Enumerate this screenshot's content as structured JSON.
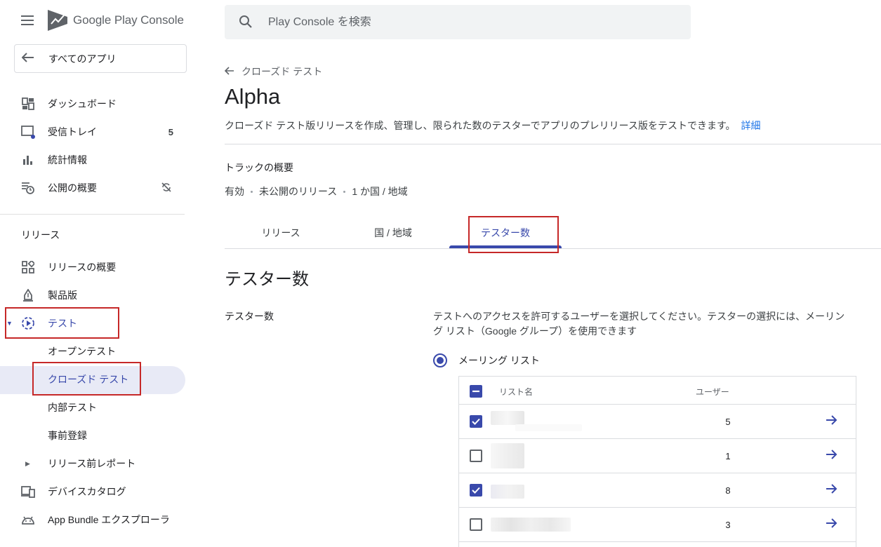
{
  "app": {
    "logo_text": "Google Play Console"
  },
  "sidebar": {
    "all_apps_label": "すべてのアプリ",
    "items": [
      {
        "label": "ダッシュボード",
        "icon": "dashboard-icon"
      },
      {
        "label": "受信トレイ",
        "icon": "inbox-icon",
        "badge": "5"
      },
      {
        "label": "統計情報",
        "icon": "bar-chart-icon"
      },
      {
        "label": "公開の概要",
        "icon": "publishing-overview-icon",
        "trail_icon": "sync-off-icon"
      }
    ],
    "section_release": "リリース",
    "release_items": [
      {
        "label": "リリースの概要",
        "icon": "release-overview-icon"
      },
      {
        "label": "製品版",
        "icon": "production-icon"
      },
      {
        "label": "テスト",
        "icon": "testing-icon"
      },
      {
        "label": "オープンテスト"
      },
      {
        "label": "クローズド テスト"
      },
      {
        "label": "内部テスト"
      },
      {
        "label": "事前登録"
      },
      {
        "label": "リリース前レポート"
      },
      {
        "label": "デバイスカタログ",
        "icon": "device-catalog-icon"
      },
      {
        "label": "App Bundle エクスプローラ",
        "icon": "android-icon"
      }
    ]
  },
  "search": {
    "placeholder": "Play Console を検索"
  },
  "main": {
    "breadcrumb": "クローズド テスト",
    "title": "Alpha",
    "description": "クローズド テスト版リリースを作成、管理し、限られた数のテスターでアプリのプレリリース版をテストできます。",
    "details_link": "詳細",
    "track_overview_title": "トラックの概要",
    "track_info": [
      "有効",
      "未公開のリリース",
      "1 か国 / 地域"
    ],
    "tabs": [
      {
        "label": "リリース",
        "active": false
      },
      {
        "label": "国 / 地域",
        "active": false
      },
      {
        "label": "テスター数",
        "active": true
      }
    ],
    "section_title": "テスター数",
    "field_label": "テスター数",
    "help_text": "テストへのアクセスを許可するユーザーを選択してください。テスターの選択には、メーリング リスト（Google グループ）を使用できます",
    "radio_label": "メーリング リスト",
    "table": {
      "headers": {
        "name": "リスト名",
        "users": "ユーザー"
      },
      "rows": [
        {
          "checked": true,
          "users": "5"
        },
        {
          "checked": false,
          "users": "1"
        },
        {
          "checked": true,
          "users": "8"
        },
        {
          "checked": false,
          "users": "3"
        }
      ]
    }
  },
  "colors": {
    "accent": "#3949ab",
    "highlight_box": "#c62828",
    "active_bg": "#e8eaf6"
  }
}
